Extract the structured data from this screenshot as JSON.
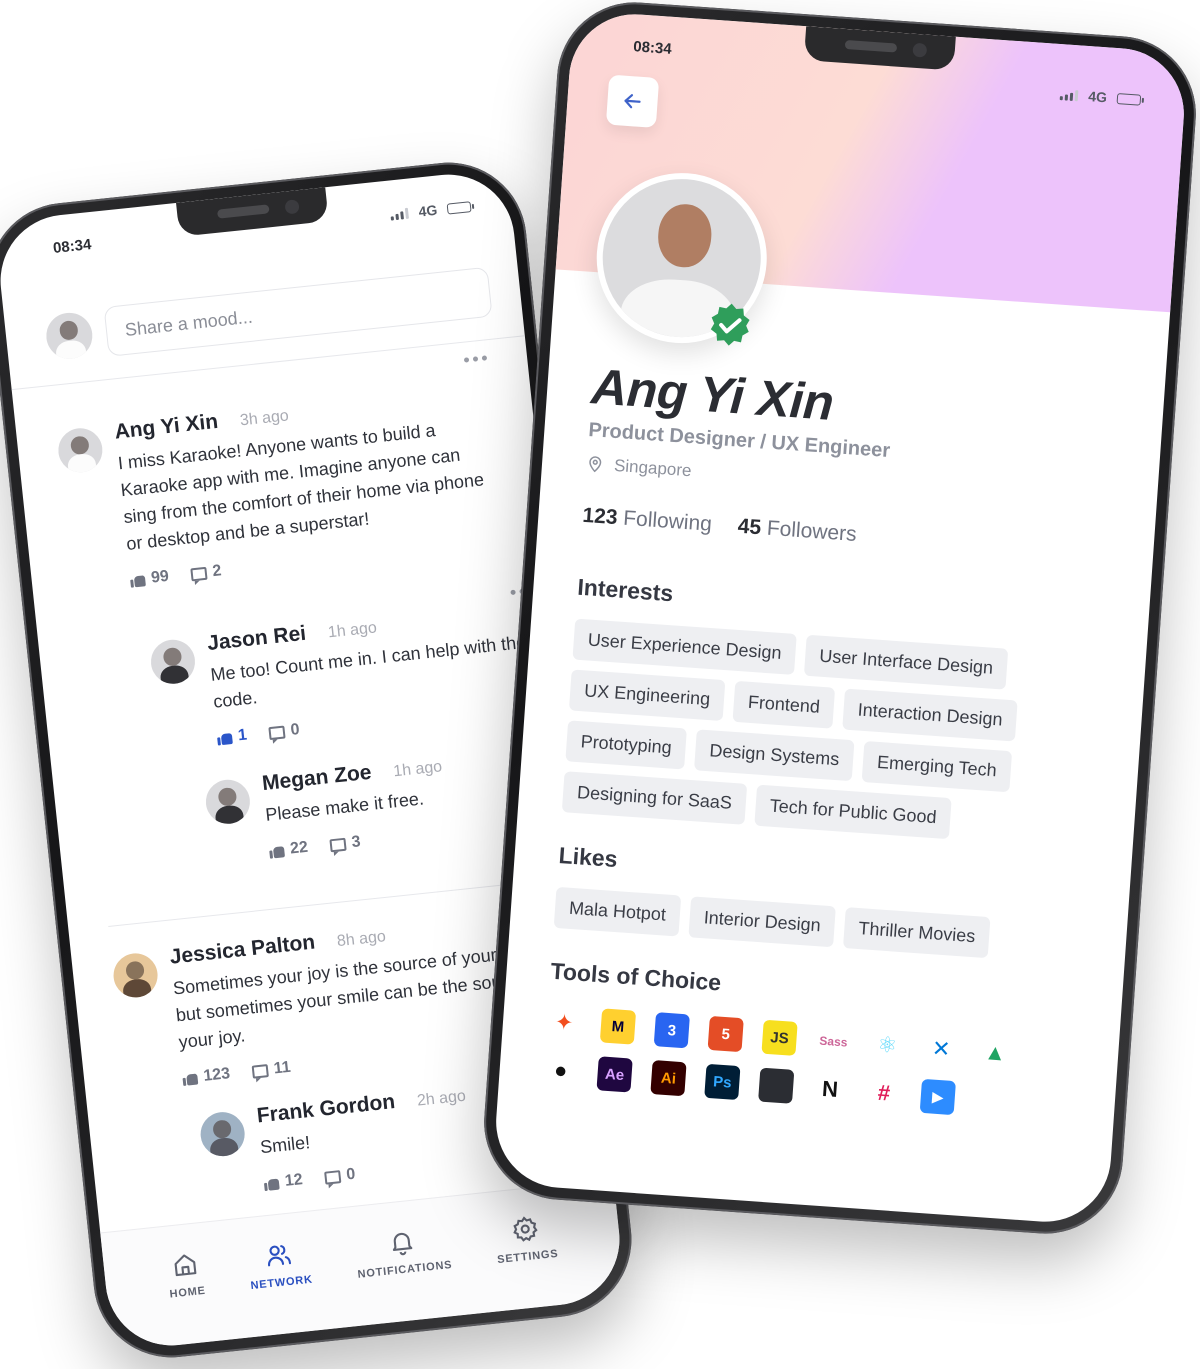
{
  "feed_screen": {
    "status_bar": {
      "time": "08:34",
      "network": "4G",
      "battery_level": 0.6
    },
    "composer": {
      "placeholder": "Share a mood..."
    },
    "posts": [
      {
        "author": "Ang Yi Xin",
        "time": "3h ago",
        "body": "I miss Karaoke! Anyone wants to build a Karaoke app with me. Imagine anyone can sing from the comfort of their home via phone or desktop and be a superstar!",
        "likes": "99",
        "comments": "2",
        "liked": false,
        "replies": [
          {
            "author": "Jason Rei",
            "time": "1h ago",
            "body": "Me too! Count me in. I can help with the code.",
            "likes": "1",
            "comments": "0",
            "liked": true
          },
          {
            "author": "Megan Zoe",
            "time": "1h ago",
            "body": "Please make it free.",
            "likes": "22",
            "comments": "3",
            "liked": false
          }
        ]
      },
      {
        "author": "Jessica Palton",
        "time": "8h ago",
        "body": "Sometimes your joy is the source of your smile, but sometimes your smile can be the source of your joy.",
        "likes": "123",
        "comments": "11",
        "liked": false,
        "replies": [
          {
            "author": "Frank Gordon",
            "time": "2h ago",
            "body": "Smile!",
            "likes": "12",
            "comments": "0",
            "liked": false
          }
        ]
      }
    ],
    "tabbar": [
      {
        "label": "HOME",
        "icon": "home-icon",
        "active": false
      },
      {
        "label": "NETWORK",
        "icon": "users-icon",
        "active": true
      },
      {
        "label": "NOTIFICATIONS",
        "icon": "bell-icon",
        "active": false
      },
      {
        "label": "SETTINGS",
        "icon": "gear-icon",
        "active": false
      }
    ]
  },
  "profile_screen": {
    "status_bar": {
      "time": "08:34",
      "network": "4G",
      "battery_level": 0.6
    },
    "cover_colors": {
      "left": "#fcd5d5",
      "right": "#edc3fb"
    },
    "accent": "#2a4fc0",
    "verified_color": "#2f9e5b",
    "name": "Ang Yi Xin",
    "role": "Product Designer / UX Engineer",
    "location": "Singapore",
    "following_count": "123",
    "following_label": "Following",
    "followers_count": "45",
    "followers_label": "Followers",
    "interests_title": "Interests",
    "interests": [
      "User Experience Design",
      "User Interface Design",
      "UX Engineering",
      "Frontend",
      "Interaction Design",
      "Prototyping",
      "Design Systems",
      "Emerging Tech",
      "Designing for SaaS",
      "Tech for Public Good"
    ],
    "likes_title": "Likes",
    "likes": [
      "Mala Hotpot",
      "Interior Design",
      "Thriller Movies"
    ],
    "tools_title": "Tools of Choice",
    "tools": [
      {
        "name": "figma-icon",
        "glyph": "✦",
        "bg": "#ffffff",
        "fg": "#f24e1e"
      },
      {
        "name": "miro-icon",
        "glyph": "M",
        "bg": "#ffd02f",
        "fg": "#050038"
      },
      {
        "name": "css3-icon",
        "glyph": "3",
        "bg": "#2965f1",
        "fg": "#ffffff"
      },
      {
        "name": "html5-icon",
        "glyph": "5",
        "bg": "#e44d26",
        "fg": "#ffffff"
      },
      {
        "name": "javascript-icon",
        "glyph": "JS",
        "bg": "#f7df1e",
        "fg": "#323330"
      },
      {
        "name": "sass-icon",
        "glyph": "Sass",
        "bg": "#ffffff",
        "fg": "#cd6799"
      },
      {
        "name": "react-icon",
        "glyph": "⚛",
        "bg": "#ffffff",
        "fg": "#61dafb"
      },
      {
        "name": "vscode-icon",
        "glyph": "✕",
        "bg": "#ffffff",
        "fg": "#0078d7"
      },
      {
        "name": "google-drive-icon",
        "glyph": "▲",
        "bg": "#ffffff",
        "fg": "#1fa463"
      },
      {
        "name": "github-icon",
        "glyph": "●",
        "bg": "#ffffff",
        "fg": "#111111"
      },
      {
        "name": "after-effects-icon",
        "glyph": "Ae",
        "bg": "#1f0740",
        "fg": "#d8a1ff"
      },
      {
        "name": "illustrator-icon",
        "glyph": "Ai",
        "bg": "#330000",
        "fg": "#ff9a00"
      },
      {
        "name": "photoshop-icon",
        "glyph": "Ps",
        "bg": "#001e36",
        "fg": "#31a8ff"
      },
      {
        "name": "apple-icon",
        "glyph": "",
        "bg": "#2b2d33",
        "fg": "#ffffff"
      },
      {
        "name": "notion-icon",
        "glyph": "N",
        "bg": "#ffffff",
        "fg": "#111111"
      },
      {
        "name": "slack-icon",
        "glyph": "#",
        "bg": "#ffffff",
        "fg": "#e01e5a"
      },
      {
        "name": "zoom-icon",
        "glyph": "▶",
        "bg": "#2d8cff",
        "fg": "#ffffff"
      }
    ]
  }
}
